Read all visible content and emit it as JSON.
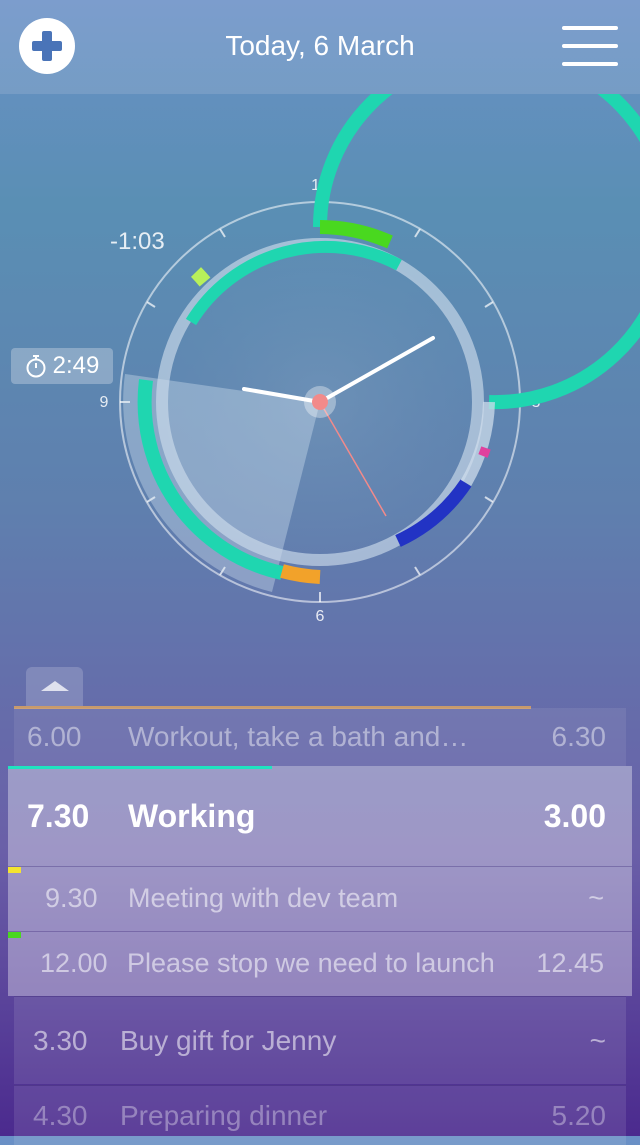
{
  "header": {
    "title": "Today, 6 March"
  },
  "clock": {
    "numerals": {
      "top": "12",
      "right": "3",
      "bottom": "6",
      "left": "9"
    },
    "countdown": "-1:03",
    "timer": "2:49"
  },
  "tasks": [
    {
      "start": "6.00",
      "title": "Workout, take a bath and…",
      "end": "6.30",
      "state": "past"
    },
    {
      "start": "7.30",
      "title": "Working",
      "end": "3.00",
      "state": "active"
    },
    {
      "start": "9.30",
      "title": "Meeting with dev team",
      "end": "~",
      "state": "subtask"
    },
    {
      "start": "12.00",
      "title": "Please stop we need to launch",
      "end": "12.45",
      "state": "subtask"
    },
    {
      "start": "3.30",
      "title": "Buy gift for Jenny",
      "end": "~",
      "state": "upcoming"
    },
    {
      "start": "4.30",
      "title": "Preparing dinner",
      "end": "5.20",
      "state": "upcoming"
    }
  ],
  "colors": {
    "teal": "#1fd6b0",
    "green": "#49d81f",
    "blue": "#2233c4",
    "orange": "#f2a22a",
    "pink": "#e0409e",
    "yellow": "#f4e430",
    "lime": "#b8f05a",
    "hand_center": "#f28a8a"
  },
  "icons": {
    "add": "plus-circle-icon",
    "menu": "hamburger-menu-icon",
    "timer": "stopwatch-icon",
    "handle": "chevron-up-icon"
  }
}
